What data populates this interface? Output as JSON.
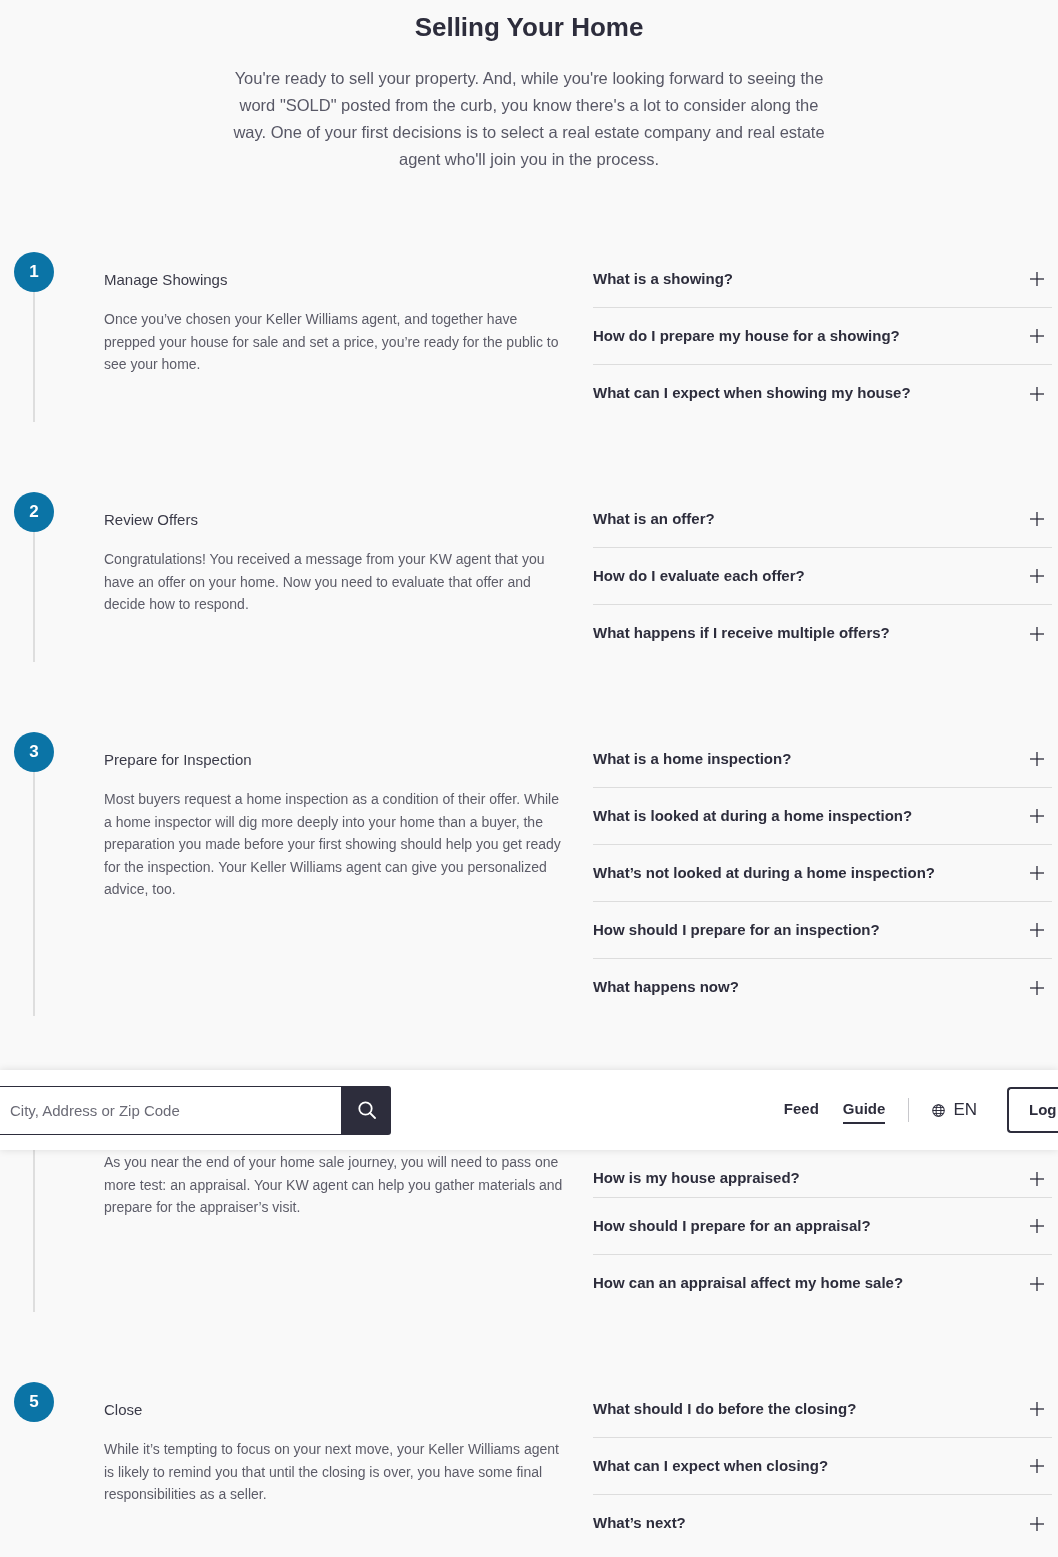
{
  "title": "Selling Your Home",
  "intro": "You're ready to sell your property. And, while you're looking forward to seeing the word \"SOLD\" posted from the curb, you know there's a lot to consider along the way. One of your first decisions is to select a real estate company and real estate agent who'll join you in the process.",
  "steps": [
    {
      "number": "1",
      "title": "Manage Showings",
      "description": "Once you’ve chosen your Keller Williams agent, and together have prepped your house for sale and set a price, you’re ready for the public to see your home.",
      "questions": [
        {
          "text": "What is a showing?",
          "expanded": false
        },
        {
          "text": "How do I prepare my house for a showing?",
          "expanded": false
        },
        {
          "text": "What can I expect when showing my house?",
          "expanded": false
        }
      ]
    },
    {
      "number": "2",
      "title": "Review Offers",
      "description": "Congratulations! You received a message from your KW agent that you have an offer on your home. Now you need to evaluate that offer and decide how to respond.",
      "questions": [
        {
          "text": "What is an offer?",
          "expanded": false
        },
        {
          "text": "How do I evaluate each offer?",
          "expanded": false
        },
        {
          "text": "What happens if I receive multiple offers?",
          "expanded": false
        }
      ]
    },
    {
      "number": "3",
      "title": "Prepare for Inspection",
      "description": "Most buyers request a home inspection as a condition of their offer. While a home inspector will dig more deeply into your home than a buyer, the preparation you made before your first showing should help you get ready for the inspection. Your Keller Williams agent can give you personalized advice, too.",
      "questions": [
        {
          "text": "What is a home inspection?",
          "expanded": false
        },
        {
          "text": "What is looked at during a home inspection?",
          "expanded": false
        },
        {
          "text": "What’s not looked at during a home inspection?",
          "expanded": false
        },
        {
          "text": "How should I prepare for an inspection?",
          "expanded": false
        },
        {
          "text": "What happens now?",
          "expanded": false
        }
      ]
    },
    {
      "description": "As you near the end of your home sale journey, you will need to pass one more test: an appraisal. Your KW agent can help you gather materials and prepare for the appraiser’s visit.",
      "questions": [
        {
          "text": "How is my house appraised?",
          "expanded": false
        },
        {
          "text": "How should I prepare for an appraisal?",
          "expanded": false
        },
        {
          "text": "How can an appraisal affect my home sale?",
          "expanded": false
        }
      ]
    },
    {
      "number": "5",
      "title": "Close",
      "description": "While it’s tempting to focus on your next move, your Keller Williams agent is likely to remind you that until the closing is over, you have some final responsibilities as a seller.",
      "questions": [
        {
          "text": "What should I do before the closing?",
          "expanded": false
        },
        {
          "text": "What can I expect when closing?",
          "expanded": false
        },
        {
          "text": "What’s next?",
          "expanded": false
        }
      ]
    }
  ],
  "nav_bar": {
    "search": {
      "placeholder": "City, Address or Zip Code"
    },
    "links": [
      {
        "label": "Feed",
        "selected": false
      },
      {
        "label": "Guide",
        "selected": true
      }
    ],
    "language": "EN",
    "login_button": "Log"
  }
}
